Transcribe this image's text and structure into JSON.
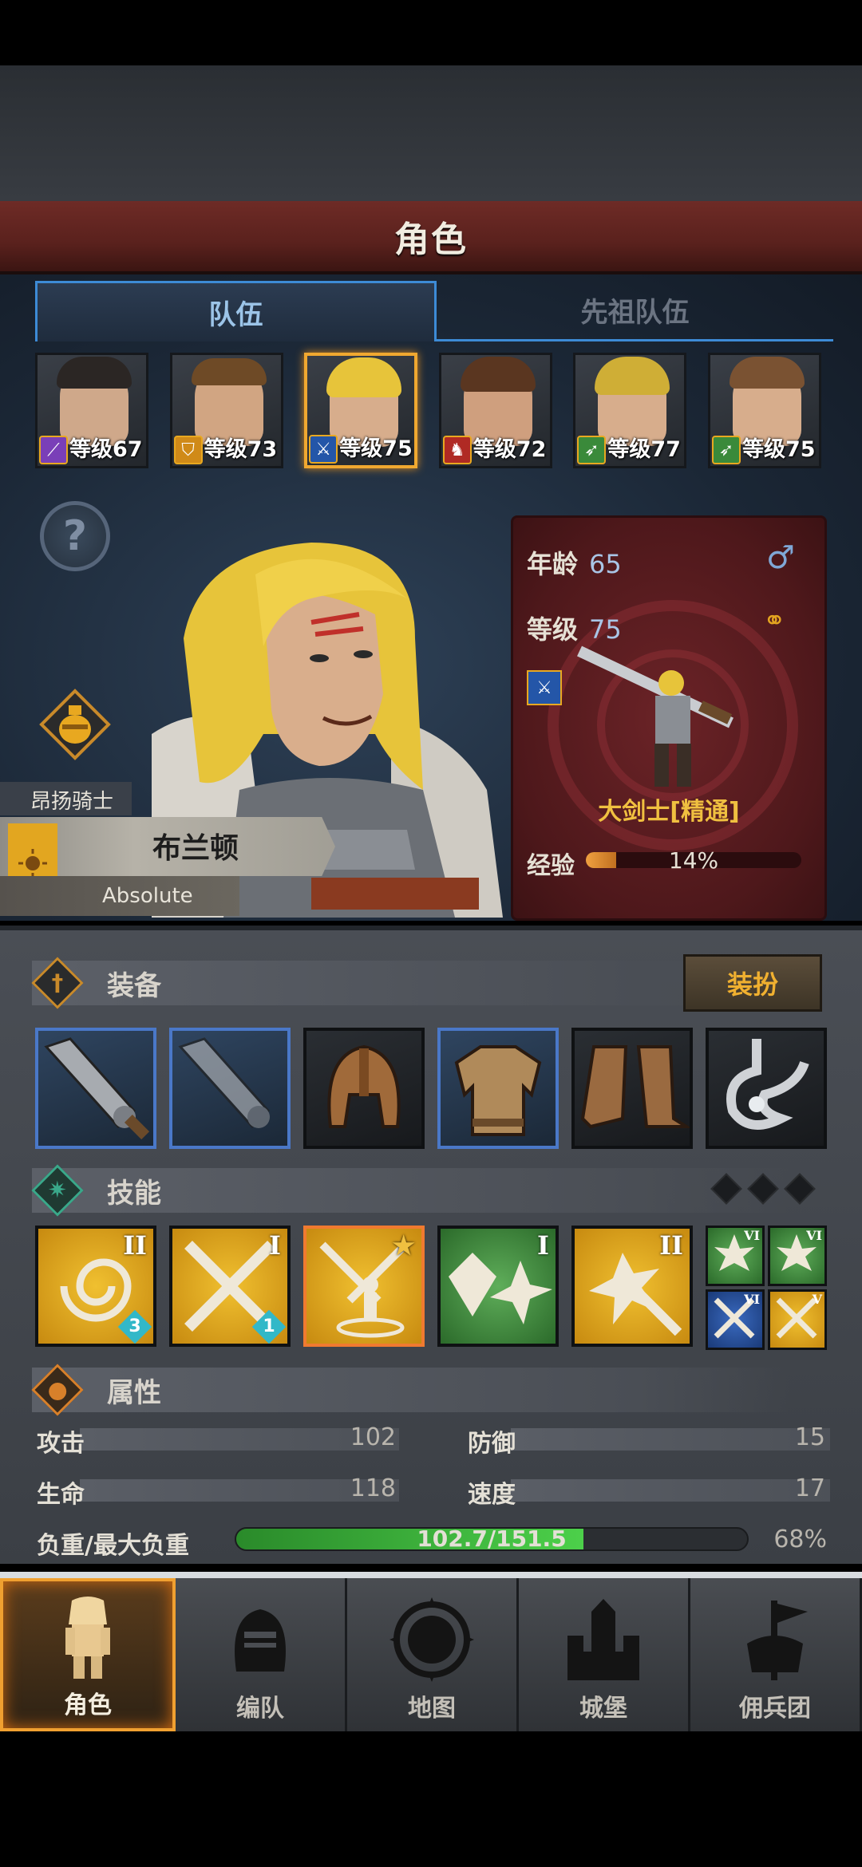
{
  "header": {
    "title": "角色"
  },
  "tabs": [
    {
      "label": "队伍"
    },
    {
      "label": "先祖队伍"
    }
  ],
  "roster": [
    {
      "level": "等级67",
      "class_icon": "staff-icon",
      "class_color": "#7a3fb8",
      "hair": "#2b2624",
      "skin": "#cfa88a"
    },
    {
      "level": "等级73",
      "class_icon": "shield-icon",
      "class_color": "#d08a18",
      "hair": "#6e4a26",
      "skin": "#d1a582"
    },
    {
      "level": "等级75",
      "class_icon": "sword-icon",
      "class_color": "#2456a8",
      "hair": "#e7c43a",
      "skin": "#d7ad8c"
    },
    {
      "level": "等级72",
      "class_icon": "horse-icon",
      "class_color": "#b02a24",
      "hair": "#5a3620",
      "skin": "#cf9f7e"
    },
    {
      "level": "等级77",
      "class_icon": "bow-icon",
      "class_color": "#3a8a3a",
      "hair": "#cfae36",
      "skin": "#d7ad8c"
    },
    {
      "level": "等级75",
      "class_icon": "bow-icon",
      "class_color": "#3a8a3a",
      "hair": "#7a5232",
      "skin": "#d7ad8c"
    }
  ],
  "hero": {
    "class_title": "昂扬骑士",
    "name": "布兰顿",
    "nickname": "Absolute",
    "age_label": "年龄",
    "age": "65",
    "level_label": "等级",
    "level": "75",
    "class_name": "大剑士[精通]",
    "exp_label": "经验",
    "exp_pct_text": "14%",
    "exp_pct": 14
  },
  "equipment": {
    "label": "装备",
    "dress_button": "装扮",
    "items": [
      {
        "name": "greatsword-icon",
        "highlight": true
      },
      {
        "name": "greatsword-icon",
        "highlight": true
      },
      {
        "name": "helmet-icon",
        "highlight": false
      },
      {
        "name": "armor-icon",
        "highlight": true
      },
      {
        "name": "boots-icon",
        "highlight": false
      },
      {
        "name": "amulet-icon",
        "highlight": false
      }
    ]
  },
  "skills": {
    "label": "技能",
    "items": [
      {
        "name": "whirlwind-skill-icon",
        "tier": "II",
        "count": "3",
        "color": "gold"
      },
      {
        "name": "crossed-swords-skill-icon",
        "tier": "I",
        "count": "1",
        "color": "gold"
      },
      {
        "name": "guard-skill-icon",
        "tier": "",
        "count": "",
        "color": "gold"
      },
      {
        "name": "shatter-skill-icon",
        "tier": "I",
        "count": "",
        "color": "green"
      },
      {
        "name": "strike-skill-icon",
        "tier": "II",
        "count": "",
        "color": "gold"
      }
    ],
    "passives": [
      {
        "tier": "VI"
      },
      {
        "tier": "VI"
      },
      {
        "tier": "VI"
      },
      {
        "tier": "V"
      }
    ]
  },
  "attributes": {
    "label": "属性",
    "attack_label": "攻击",
    "attack": "102",
    "defense_label": "防御",
    "defense": "15",
    "hp_label": "生命",
    "hp": "118",
    "speed_label": "速度",
    "speed": "17",
    "load_label": "负重/最大负重",
    "load_text": "102.7/151.5",
    "load_pct_text": "68%",
    "load_pct": 68
  },
  "nav": [
    {
      "label": "角色",
      "icon": "knight-icon"
    },
    {
      "label": "编队",
      "icon": "helmet-icon"
    },
    {
      "label": "地图",
      "icon": "compass-map-icon"
    },
    {
      "label": "城堡",
      "icon": "castle-icon"
    },
    {
      "label": "佣兵团",
      "icon": "mercenary-banner-icon"
    }
  ]
}
